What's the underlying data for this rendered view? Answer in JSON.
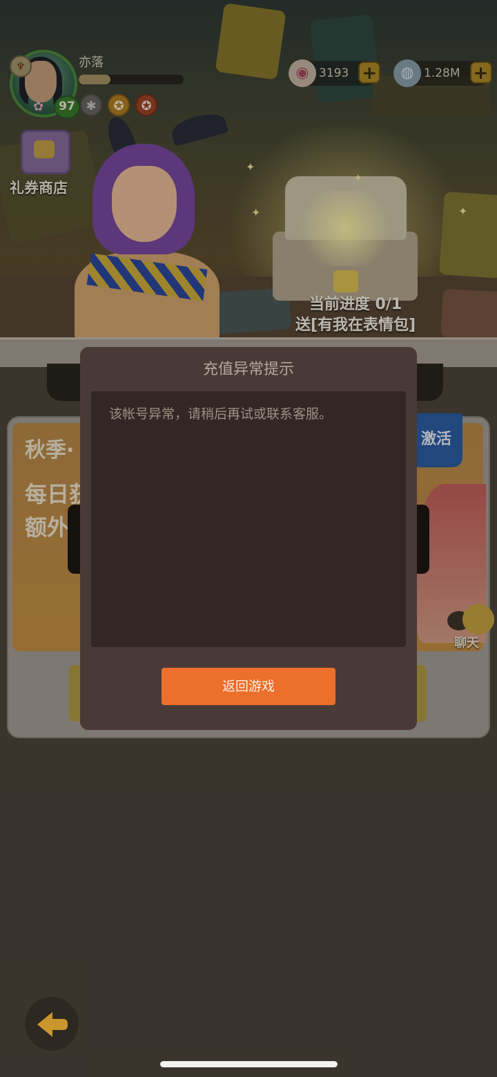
{
  "player": {
    "name": "亦落",
    "level": "97",
    "exp_fraction": 0.3
  },
  "shop": {
    "label": "礼券商店"
  },
  "currencies": [
    {
      "icon": "shell-icon",
      "value": "3193"
    },
    {
      "icon": "pearl-icon",
      "value": "1.28M"
    }
  ],
  "reward": {
    "progress_text": "当前进度 0/1",
    "reward_text": "送[有我在表情包]"
  },
  "event_card": {
    "title": "秋季·",
    "line1": "每日获",
    "line2": "额外",
    "tag": "激活"
  },
  "chat": {
    "label": "聊天"
  },
  "dialog": {
    "title": "充值异常提示",
    "message": "该帐号异常，请稍后再试或联系客服。",
    "button_label": "返回游戏"
  },
  "colors": {
    "accent_button": "#ec6f2c",
    "dialog_bg": "#4a3a37",
    "dialog_body_bg": "#332726"
  }
}
